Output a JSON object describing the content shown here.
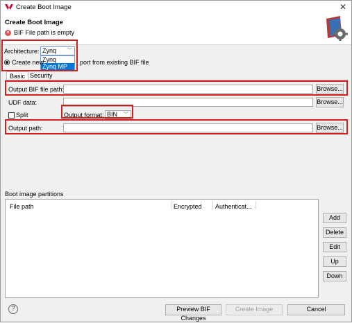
{
  "window": {
    "title": "Create Boot Image",
    "close_glyph": "✕"
  },
  "header": {
    "title": "Create Boot Image",
    "error_message": "BIF File path is empty"
  },
  "architecture": {
    "label": "Architecture:",
    "selected": "Zynq",
    "options": [
      "Zynq",
      "Zynq MP"
    ],
    "highlighted_option": "Zynq MP"
  },
  "mode": {
    "create_new_label_visible": "Create new",
    "import_label_visible": "port from existing BIF file"
  },
  "tabs": {
    "basic": "Basic",
    "security": "Security"
  },
  "form": {
    "output_bif_label": "Output BIF file path:",
    "output_bif_value": "",
    "udf_label": "UDF data:",
    "udf_value": "",
    "split_label": "Split",
    "output_format_label": "Output format:",
    "output_format_value": "BIN",
    "output_path_label": "Output path:",
    "output_path_value": "",
    "browse_label": "Browse..."
  },
  "partitions": {
    "section_label": "Boot image partitions",
    "columns": [
      "File path",
      "Encrypted",
      "Authenticat..."
    ],
    "rows": [],
    "buttons": {
      "add": "Add",
      "delete": "Delete",
      "edit": "Edit",
      "up": "Up",
      "down": "Down"
    }
  },
  "footer": {
    "help_glyph": "?",
    "preview_label": "Preview BIF Changes",
    "create_label": "Create Image",
    "cancel_label": "Cancel"
  },
  "colors": {
    "highlight_box": "#d21e1e",
    "selection": "#0078d7",
    "error": "#d9534f"
  }
}
